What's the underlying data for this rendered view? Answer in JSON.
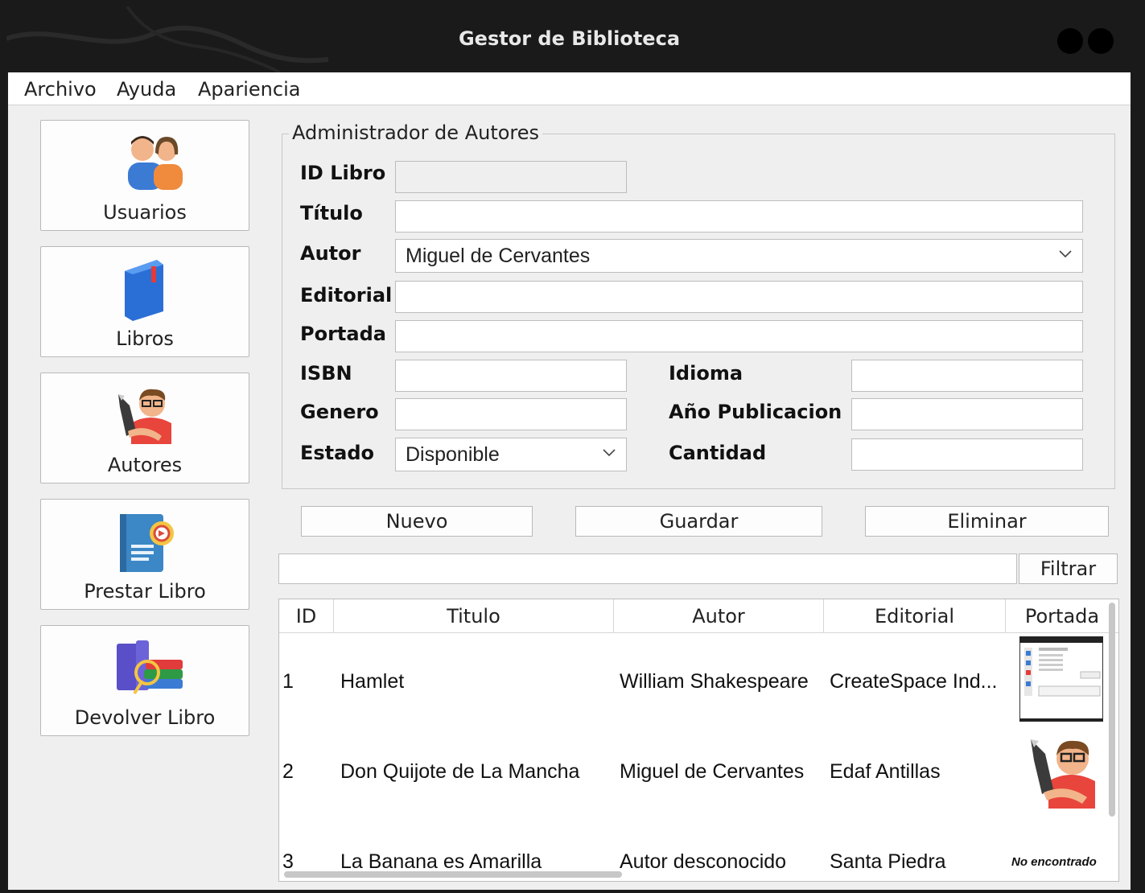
{
  "window": {
    "title": "Gestor de Biblioteca"
  },
  "menu": [
    "Archivo",
    "Ayuda",
    "Apariencia"
  ],
  "sidebar": [
    {
      "label": "Usuarios",
      "icon": "users-icon"
    },
    {
      "label": "Libros",
      "icon": "book-icon"
    },
    {
      "label": "Autores",
      "icon": "author-icon"
    },
    {
      "label": "Prestar Libro",
      "icon": "lend-book-icon"
    },
    {
      "label": "Devolver Libro",
      "icon": "return-book-icon"
    }
  ],
  "form": {
    "group_title": "Administrador de Autores",
    "id_label": "ID Libro",
    "titulo_label": "Título",
    "autor_label": "Autor",
    "autor_value": "Miguel de Cervantes",
    "editorial_label": "Editorial",
    "portada_label": "Portada",
    "isbn_label": "ISBN",
    "idioma_label": "Idioma",
    "genero_label": "Genero",
    "anio_label": "Año Publicacion",
    "estado_label": "Estado",
    "estado_value": "Disponible",
    "cantidad_label": "Cantidad"
  },
  "actions": {
    "nuevo": "Nuevo",
    "guardar": "Guardar",
    "eliminar": "Eliminar",
    "filtrar": "Filtrar"
  },
  "table": {
    "columns": [
      "ID",
      "Titulo",
      "Autor",
      "Editorial",
      "Portada"
    ],
    "rows": [
      {
        "id": "1",
        "titulo": "Hamlet",
        "autor": "William Shakespeare",
        "editorial": "CreateSpace Ind...",
        "portada": "screenshot-thumbnail"
      },
      {
        "id": "2",
        "titulo": "Don Quijote de La Mancha",
        "autor": "Miguel de Cervantes",
        "editorial": "Edaf Antillas",
        "portada": "author-icon"
      },
      {
        "id": "3",
        "titulo": "La Banana es Amarilla",
        "autor": "Autor desconocido",
        "editorial": "Santa Piedra",
        "portada": "No encontrado"
      }
    ]
  }
}
